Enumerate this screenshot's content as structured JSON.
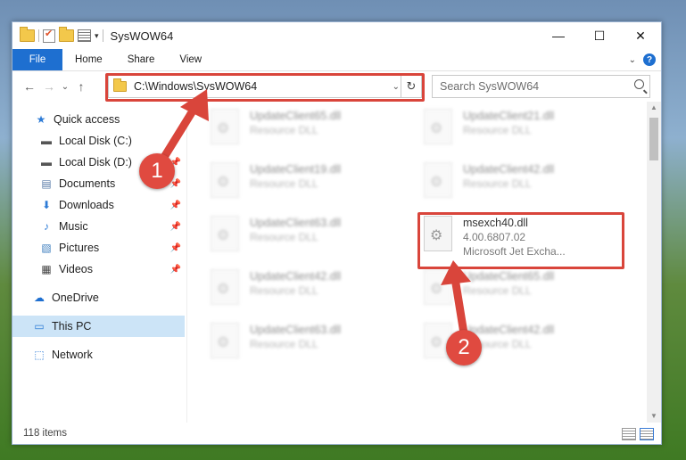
{
  "window": {
    "title": "SysWOW64",
    "controls": {
      "minimize": "—",
      "maximize": "☐",
      "close": "✕"
    }
  },
  "ribbon": {
    "tabs": [
      {
        "label": "File"
      },
      {
        "label": "Home"
      },
      {
        "label": "Share"
      },
      {
        "label": "View"
      }
    ],
    "help": "?"
  },
  "navigation": {
    "back": "←",
    "forward": "→",
    "recent": "⌄",
    "up": "↑",
    "address": "C:\\Windows\\SysWOW64",
    "refresh": "↻",
    "search_placeholder": "Search SysWOW64"
  },
  "sidebar": {
    "items": [
      {
        "label": "Quick access",
        "icon": "star-icon"
      },
      {
        "label": "Local Disk (C:)",
        "icon": "drive-icon"
      },
      {
        "label": "Local Disk (D:)",
        "icon": "drive-icon"
      },
      {
        "label": "Documents",
        "icon": "documents-icon"
      },
      {
        "label": "Downloads",
        "icon": "download-icon"
      },
      {
        "label": "Music",
        "icon": "music-icon"
      },
      {
        "label": "Pictures",
        "icon": "pictures-icon"
      },
      {
        "label": "Videos",
        "icon": "videos-icon"
      },
      {
        "label": "OneDrive",
        "icon": "cloud-icon"
      },
      {
        "label": "This PC",
        "icon": "computer-icon"
      },
      {
        "label": "Network",
        "icon": "network-icon"
      }
    ]
  },
  "files": [
    {
      "name": "UpdateClient65.dll",
      "type": "Resource DLL"
    },
    {
      "name": "UpdateClient21.dll",
      "type": "Resource DLL"
    },
    {
      "name": "UpdateClient19.dll",
      "type": "Resource DLL"
    },
    {
      "name": "UpdateClient42.dll",
      "type": "Resource DLL"
    },
    {
      "name": "UpdateClient63.dll",
      "type": "Resource DLL"
    },
    {
      "name": "msexch40.dll",
      "version": "4.00.6807.02",
      "description": "Microsoft Jet Excha..."
    },
    {
      "name": "UpdateClient42.dll",
      "type": "Resource DLL"
    },
    {
      "name": "UpdateClient65.dll",
      "type": "Resource DLL"
    },
    {
      "name": "UpdateClient63.dll",
      "type": "Resource DLL"
    },
    {
      "name": "UpdateClient42.dll",
      "type": "Resource DLL"
    }
  ],
  "status": {
    "item_count": "118 items"
  },
  "callouts": [
    {
      "label": "1"
    },
    {
      "label": "2"
    }
  ],
  "colors": {
    "highlight": "#d9453b",
    "accent": "#1e6fd0",
    "selection": "#cce4f7"
  }
}
